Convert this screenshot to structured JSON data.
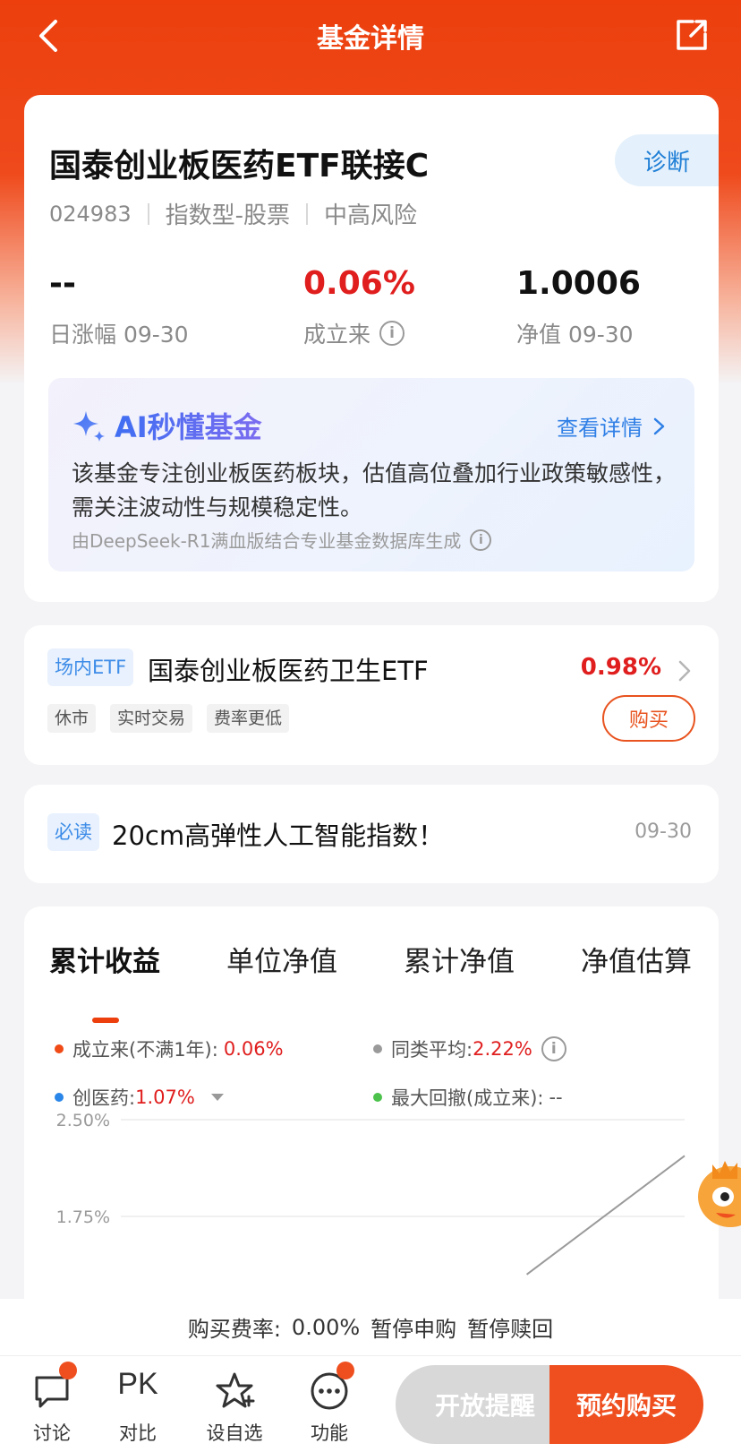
{
  "nav": {
    "title": "基金详情"
  },
  "fund": {
    "name": "国泰创业板医药ETF联接C",
    "diagnose_label": "诊断",
    "code": "024983",
    "type": "指数型-股票",
    "risk": "中高风险",
    "stats": [
      {
        "value": "--",
        "label": "日涨幅 09-30"
      },
      {
        "value": "0.06%",
        "label": "成立来"
      },
      {
        "value": "1.0006",
        "label": "净值 09-30"
      }
    ]
  },
  "ai": {
    "title": "AI秒懂基金",
    "more_label": "查看详情",
    "desc": "该基金专注创业板医药板块，估值高位叠加行业政策敏感性，需关注波动性与规模稳定性。",
    "source": "由DeepSeek-R1满血版结合专业基金数据库生成"
  },
  "etf": {
    "tag": "场内ETF",
    "name": "国泰创业板医药卫生ETF",
    "rate": "0.98%",
    "chips": [
      "休市",
      "实时交易",
      "费率更低"
    ],
    "buy_label": "购买"
  },
  "news": {
    "tag": "必读",
    "title": "20cm高弹性人工智能指数！",
    "date": "09-30"
  },
  "chart_tabs": [
    "累计收益",
    "单位净值",
    "累计净值",
    "净值估算"
  ],
  "legend": [
    {
      "label": "成立来(不满1年):",
      "value": "0.06%",
      "color": "#f04a16"
    },
    {
      "label": "同类平均:",
      "value": "2.22%",
      "color": "#9a9a9a"
    },
    {
      "label": "创医药:",
      "value": "1.07%",
      "color": "#2a86e8"
    },
    {
      "label": "最大回撤(成立来):",
      "value": "--",
      "color": "#4cc24c"
    }
  ],
  "chart_data": {
    "type": "line",
    "y_ticks": [
      "2.50%",
      "1.75%"
    ],
    "ylim_visible": [
      1.75,
      2.5
    ],
    "series": [
      {
        "name": "同类平均",
        "color": "#9a9a9a",
        "points": [
          [
            0.72,
            1.3
          ],
          [
            1.0,
            2.22
          ]
        ]
      }
    ]
  },
  "fee_bar": {
    "label": "购买费率:",
    "rate": "0.00%",
    "status1": "暂停申购",
    "status2": "暂停赎回"
  },
  "bottom": {
    "items": [
      "讨论",
      "对比",
      "设自选",
      "功能"
    ],
    "pk": "PK",
    "remind_label": "开放提醒",
    "buy_label": "预约购买"
  }
}
